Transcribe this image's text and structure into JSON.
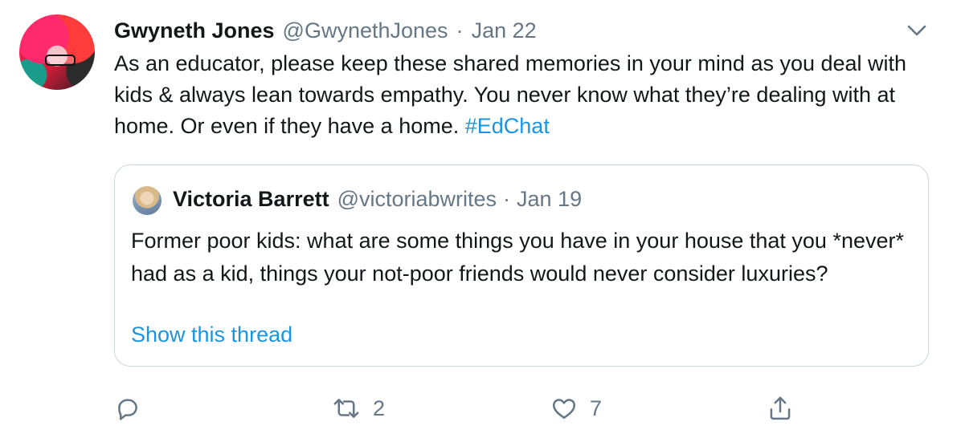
{
  "tweet": {
    "author_name": "Gwyneth Jones",
    "author_handle": "@GwynethJones",
    "separator": "·",
    "date": "Jan 22",
    "text": "As an educator, please keep these shared memories in your mind as you deal with kids & always lean towards empathy. You never know what they’re dealing with at home. Or even if they have a home.",
    "hashtag": "#EdChat"
  },
  "quoted_tweet": {
    "author_name": "Victoria Barrett",
    "author_handle": "@victoriabwrites",
    "separator": "·",
    "date": "Jan 19",
    "text": "Former poor kids: what are some things you have in your house that you *never* had as a kid, things your not-poor friends would never consider luxuries?",
    "show_thread": "Show this thread"
  },
  "actions": {
    "reply_icon": "reply-icon",
    "retweet_icon": "retweet-icon",
    "retweet_count": "2",
    "like_icon": "heart-icon",
    "like_count": "7",
    "share_icon": "share-icon"
  },
  "colors": {
    "text": "#14171a",
    "secondary": "#657786",
    "link": "#1b95e0",
    "border": "#ccd6dd"
  }
}
